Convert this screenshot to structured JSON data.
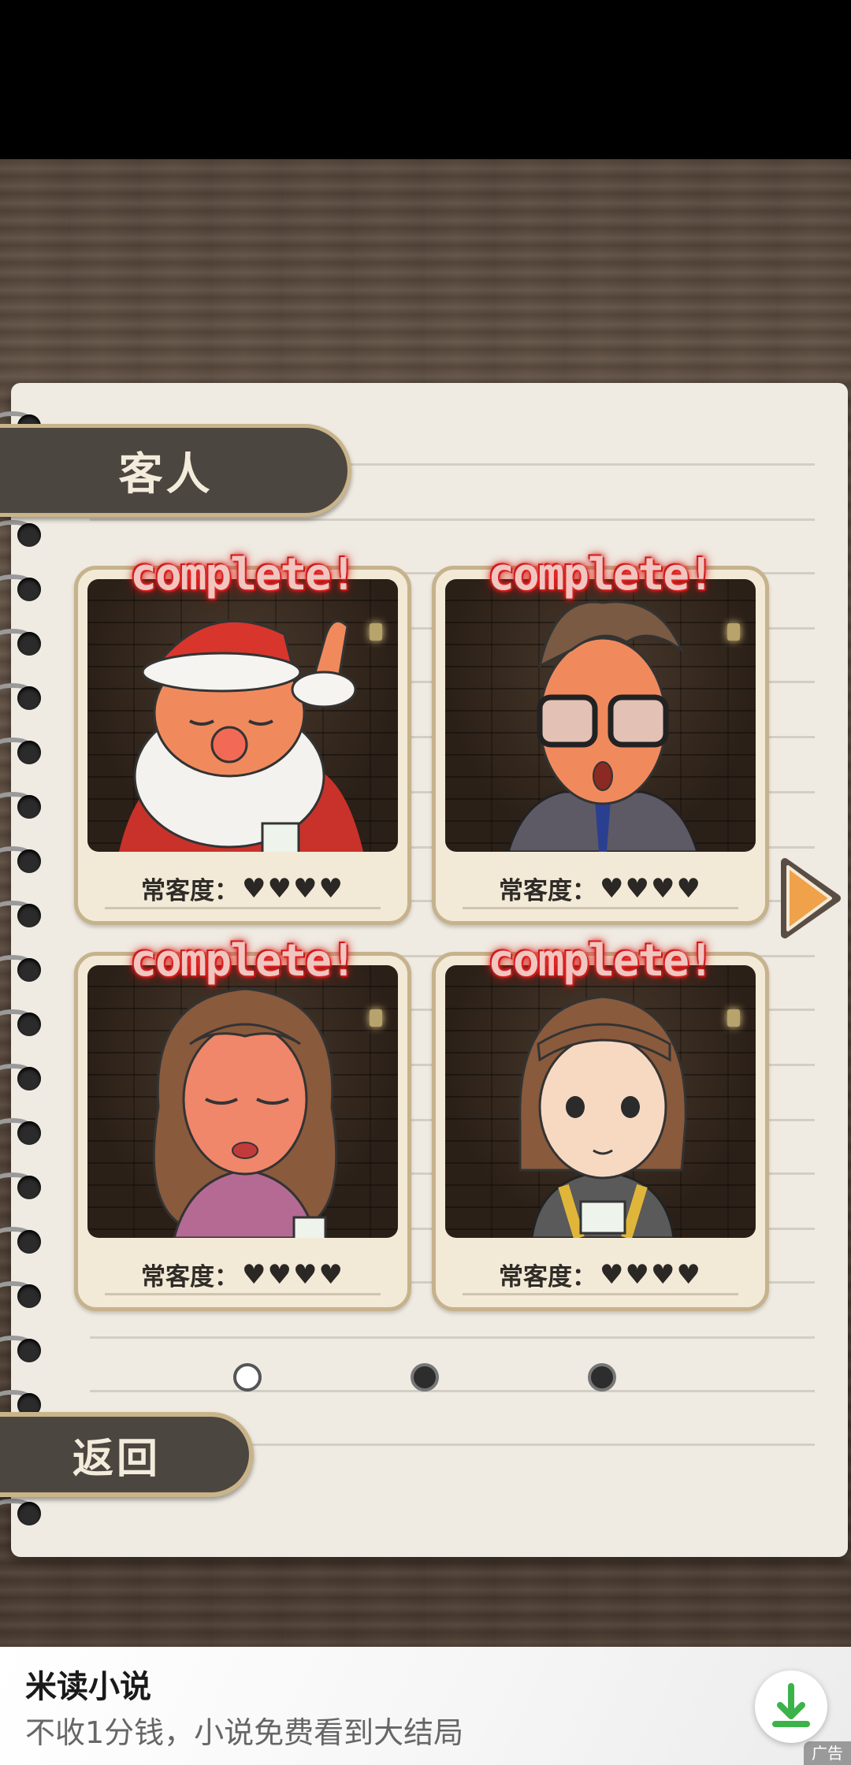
{
  "header": {
    "title": "客人"
  },
  "cards": [
    {
      "complete": "complete!",
      "regular_label": "常客度：",
      "hearts": "♥♥♥♥",
      "portrait_icon": "santa-portrait"
    },
    {
      "complete": "complete!",
      "regular_label": "常客度：",
      "hearts": "♥♥♥♥",
      "portrait_icon": "glasses-man-portrait"
    },
    {
      "complete": "complete!",
      "regular_label": "常客度：",
      "hearts": "♥♥♥♥",
      "portrait_icon": "long-hair-woman-portrait"
    },
    {
      "complete": "complete!",
      "regular_label": "常客度：",
      "hearts": "♥♥♥♥",
      "portrait_icon": "bob-hair-girl-portrait"
    }
  ],
  "pagination": {
    "current": 1,
    "total": 3
  },
  "back_button": {
    "label": "返回"
  },
  "ad": {
    "title": "米读小说",
    "description": "不收1分钱，小说免费看到大结局",
    "tag": "广告",
    "accent": "#3cb34a"
  },
  "colors": {
    "tab": "#4c4640",
    "tab_border": "#c9b48a",
    "arrow": "#f0a24a",
    "paper": "#efebe2"
  }
}
